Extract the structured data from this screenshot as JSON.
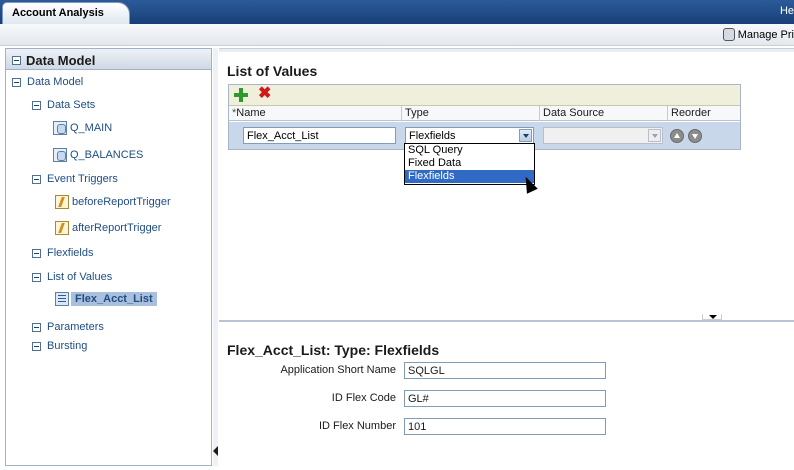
{
  "window": {
    "app_tab": "Account Analysis",
    "top_right_text": "He",
    "manage_label": "Manage Pri"
  },
  "left_panel": {
    "header": "Data Model",
    "tree": {
      "root": "Data Model",
      "data_sets": "Data Sets",
      "q_main": "Q_MAIN",
      "q_balances": "Q_BALANCES",
      "event_triggers": "Event Triggers",
      "before_trigger": "beforeReportTrigger",
      "after_trigger": "afterReportTrigger",
      "flexfields": "Flexfields",
      "list_of_values": "List of Values",
      "flex_acct_list": "Flex_Acct_List",
      "parameters": "Parameters",
      "bursting": "Bursting"
    }
  },
  "lov_section": {
    "title": "List of Values",
    "columns": {
      "required_mark": "*",
      "name": "Name",
      "type": "Type",
      "data_source": "Data Source",
      "reorder": "Reorder"
    },
    "row": {
      "name_value": "Flex_Acct_List",
      "type_value": "Flexfields",
      "data_source_value": ""
    },
    "type_options": [
      "SQL Query",
      "Fixed Data",
      "Flexfields"
    ],
    "selected_option": "Flexfields"
  },
  "detail_section": {
    "title": "Flex_Acct_List: Type: Flexfields",
    "fields": [
      {
        "label": "Application Short Name",
        "value": "SQLGL"
      },
      {
        "label": "ID Flex Code",
        "value": "GL#"
      },
      {
        "label": "ID Flex Number",
        "value": "101"
      }
    ]
  }
}
